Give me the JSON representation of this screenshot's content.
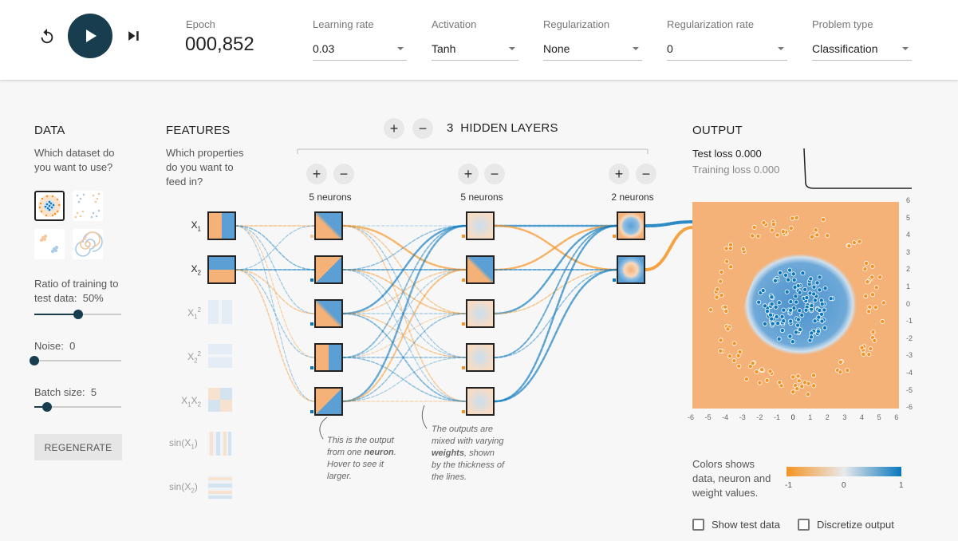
{
  "controls": {
    "reset_icon": "reset-icon",
    "play_icon": "play-icon",
    "step_icon": "step-forward-icon",
    "epoch_label": "Epoch",
    "epoch_value": "000,852",
    "learning_rate": {
      "label": "Learning rate",
      "value": "0.03"
    },
    "activation": {
      "label": "Activation",
      "value": "Tanh"
    },
    "regularization": {
      "label": "Regularization",
      "value": "None"
    },
    "regularization_rate": {
      "label": "Regularization rate",
      "value": "0"
    },
    "problem_type": {
      "label": "Problem type",
      "value": "Classification"
    }
  },
  "data_panel": {
    "title": "DATA",
    "question_line1": "Which dataset do",
    "question_line2": "you want to use?",
    "ratio_label_line1": "Ratio of training to",
    "ratio_label_line2": "test data:",
    "ratio_value": "50%",
    "ratio_fraction": 0.5,
    "noise_label": "Noise:",
    "noise_value": "0",
    "noise_fraction": 0.0,
    "batch_label": "Batch size:",
    "batch_value": "5",
    "batch_fraction": 0.15,
    "regenerate": "REGENERATE"
  },
  "features_panel": {
    "title": "FEATURES",
    "question_line1": "Which properties",
    "question_line2": "do you want to",
    "question_line3": "feed in?",
    "features": [
      "X1",
      "X2",
      "X1²",
      "X2²",
      "X1X2",
      "sin(X1)",
      "sin(X2)"
    ]
  },
  "network": {
    "hidden_layers_count": "3",
    "hidden_layers_label": "HIDDEN LAYERS",
    "layer1_label": "5 neurons",
    "layer2_label": "5 neurons",
    "layer3_label": "2 neurons",
    "annotation1_a": "This is the output",
    "annotation1_b": "from one",
    "annotation1_bold": "neuron",
    "annotation1_c": "Hover to see it",
    "annotation1_d": "larger.",
    "annotation2_a": "The outputs are",
    "annotation2_b": "mixed with varying",
    "annotation2_bold": "weights",
    "annotation2_c": ", shown",
    "annotation2_d": "by the thickness of",
    "annotation2_e": "the lines."
  },
  "output_panel": {
    "title": "OUTPUT",
    "test_loss": "Test loss 0.000",
    "training_loss": "Training loss 0.000",
    "axis_ticks": [
      "6",
      "5",
      "4",
      "3",
      "2",
      "1",
      "0",
      "-1",
      "-2",
      "-3",
      "-4",
      "-5",
      "-6"
    ],
    "x_ticks": [
      "-6",
      "-5",
      "-4",
      "-3",
      "-2",
      "-1",
      "0",
      "1",
      "2",
      "3",
      "4",
      "5",
      "6"
    ],
    "legend_text_1": "Colors shows",
    "legend_text_2": "data, neuron and",
    "legend_text_3": "weight values.",
    "legend_min": "-1",
    "legend_mid": "0",
    "legend_max": "1",
    "show_test_data": "Show test data",
    "discretize_output": "Discretize output"
  },
  "colors": {
    "orange": "#f59322",
    "blue": "#0877bd",
    "bg_orange": "#f4b178",
    "bg_blue": "#5b9fd4",
    "dark": "#183d4e"
  }
}
